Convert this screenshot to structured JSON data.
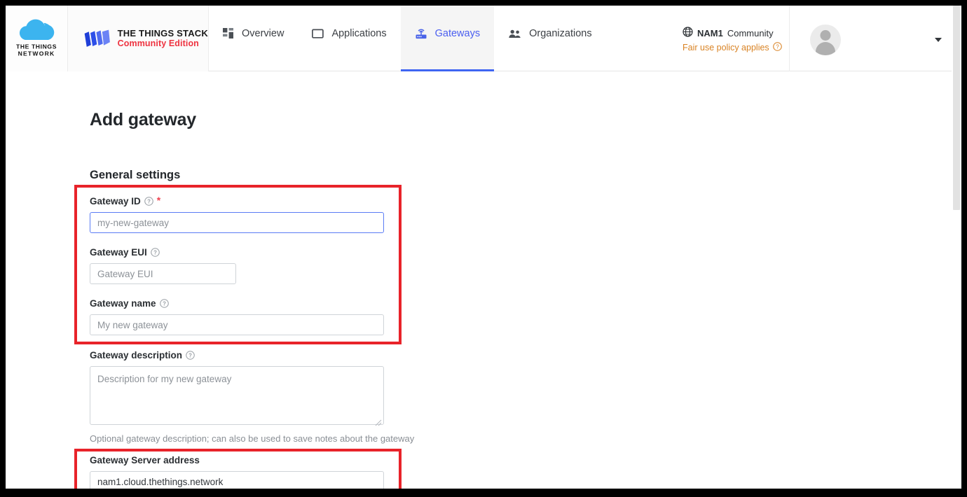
{
  "brand": {
    "ttn_logo_line1": "THE THINGS",
    "ttn_logo_line2": "NETWORK",
    "stack_title": "THE THINGS STACK",
    "stack_subtitle": "Community Edition",
    "stack_accent_color": "#ee3340"
  },
  "nav": {
    "items": [
      {
        "label": "Overview",
        "icon": "grid-icon",
        "active": false
      },
      {
        "label": "Applications",
        "icon": "application-icon",
        "active": false
      },
      {
        "label": "Gateways",
        "icon": "gateway-router-icon",
        "active": true
      },
      {
        "label": "Organizations",
        "icon": "organizations-people-icon",
        "active": false
      }
    ],
    "active_color": "#4a5ef0",
    "active_underline_color": "#3f65f2"
  },
  "cluster": {
    "icon": "globe-icon",
    "name": "NAM1",
    "type": "Community",
    "policy_text": "Fair use policy applies",
    "policy_icon": "question-circle-icon",
    "policy_color": "#d98324"
  },
  "account": {
    "avatar_icon": "user-avatar-icon",
    "dropdown_icon": "chevron-down-icon"
  },
  "page": {
    "title": "Add gateway",
    "section_title": "General settings"
  },
  "form": {
    "fields": [
      {
        "label": "Gateway ID",
        "has_help": true,
        "required": true,
        "placeholder": "my-new-gateway",
        "value": "",
        "focused": true
      },
      {
        "label": "Gateway EUI",
        "has_help": true,
        "required": false,
        "placeholder": "Gateway EUI",
        "value": "",
        "focused": false
      },
      {
        "label": "Gateway name",
        "has_help": true,
        "required": false,
        "placeholder": "My new gateway",
        "value": "",
        "focused": false
      },
      {
        "label": "Gateway description",
        "has_help": true,
        "required": false,
        "placeholder": "Description for my new gateway",
        "value": "",
        "focused": false,
        "help_text": "Optional gateway description; can also be used to save notes about the gateway"
      },
      {
        "label": "Gateway Server address",
        "has_help": false,
        "required": false,
        "placeholder": "",
        "value": "nam1.cloud.thethings.network",
        "focused": false
      }
    ]
  },
  "annotations": {
    "color": "#e8232a",
    "boxes": [
      {
        "name": "general-settings-highlight"
      },
      {
        "name": "gateway-server-address-highlight"
      }
    ]
  },
  "scrollbar": {
    "thumb_color": "#e2e2e2"
  }
}
